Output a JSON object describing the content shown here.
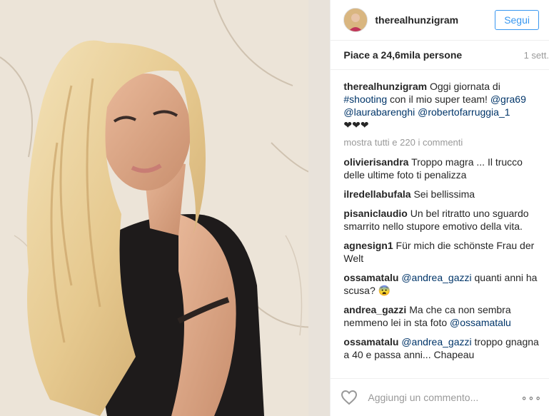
{
  "post": {
    "username": "therealhunzigram",
    "follow_label": "Segui",
    "likes": "Piace a 24,6mila persone",
    "time": "1 sett.",
    "caption": {
      "user": "therealhunzigram",
      "text1": "Oggi giornata di",
      "hashtag": "#shooting",
      "text2": "con il mio super team!",
      "tag1": "@gra69",
      "tag2": "@laurabarenghi",
      "tag3": "@robertofarruggia_1",
      "hearts": "❤❤❤"
    },
    "more_comments": "mostra tutti e 220 i commenti",
    "comments": [
      {
        "user": "olivierisandra",
        "text": "Troppo magra ... Il trucco delle ultime foto ti penalizza"
      },
      {
        "user": "ilredellabufala",
        "text": "Sei bellissima"
      },
      {
        "user": "pisaniclaudio",
        "text": "Un bel ritratto uno sguardo smarrito nello stupore emotivo della vita."
      },
      {
        "user": "agnesign1",
        "text": "Für mich die schönste Frau der Welt"
      },
      {
        "user": "ossamatalu",
        "mention": "@andrea_gazzi",
        "text": "quanti anni ha scusa? 😨"
      },
      {
        "user": "andrea_gazzi",
        "text": "Ma che ca non sembra nemmeno lei in sta foto",
        "mention": "@ossamatalu"
      },
      {
        "user": "ossamatalu",
        "mention": "@andrea_gazzi",
        "text": "troppo gnagna a 40 e passa anni... Chapeau"
      }
    ],
    "add_comment_placeholder": "Aggiungi un commento...",
    "options_icon": "∘∘∘"
  }
}
